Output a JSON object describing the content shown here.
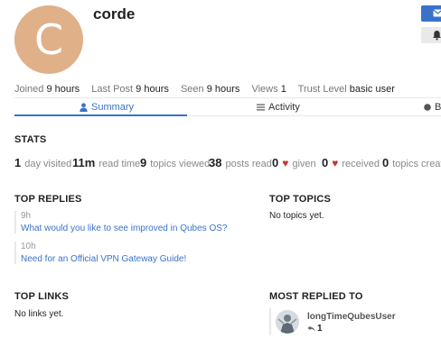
{
  "profile": {
    "avatar_letter": "C",
    "avatar_color": "#e0b088",
    "username": "corde"
  },
  "meta": {
    "joined_label": "Joined",
    "joined_value": "9 hours",
    "last_post_label": "Last Post",
    "last_post_value": "9 hours",
    "seen_label": "Seen",
    "seen_value": "9 hours",
    "views_label": "Views",
    "views_value": "1",
    "trust_label": "Trust Level",
    "trust_value": "basic user"
  },
  "tabs": {
    "summary": "Summary",
    "activity": "Activity",
    "badges": "Ba"
  },
  "stats": {
    "title": "STATS",
    "days_visited": {
      "value": "1",
      "label": "day visited"
    },
    "read_time": {
      "value": "11m",
      "label": "read time"
    },
    "topics_viewed": {
      "value": "9",
      "label": "topics viewed"
    },
    "posts_read": {
      "value": "38",
      "label": "posts read"
    },
    "given": {
      "value": "0",
      "label": "given"
    },
    "received": {
      "value": "0",
      "label": "received"
    },
    "topics_created": {
      "value": "0",
      "label": "topics created"
    }
  },
  "top_replies": {
    "title": "TOP REPLIES",
    "items": [
      {
        "time": "9h",
        "title": "What would you like to see improved in Qubes OS?"
      },
      {
        "time": "10h",
        "title": "Need for an Official VPN Gateway Guide!"
      }
    ]
  },
  "top_topics": {
    "title": "TOP TOPICS",
    "empty": "No topics yet."
  },
  "top_links": {
    "title": "TOP LINKS",
    "empty": "No links yet."
  },
  "most_replied": {
    "title": "MOST REPLIED TO",
    "user": "longTimeQubesUser",
    "count": "1"
  },
  "colors": {
    "accent": "#3a72c9",
    "heart": "#c0392b"
  },
  "icons": [
    "envelope-icon",
    "bell-icon",
    "user-icon",
    "list-icon",
    "badge-icon",
    "heart-icon",
    "reply-icon"
  ]
}
